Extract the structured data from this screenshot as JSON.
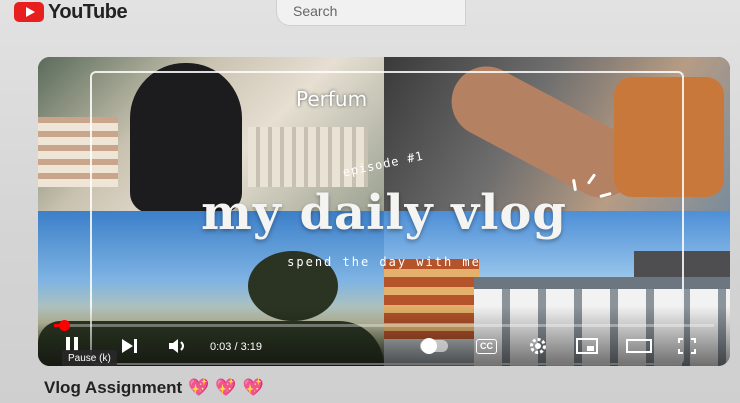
{
  "header": {
    "logo_text": "YouTube",
    "search_placeholder": "Search"
  },
  "player": {
    "overlay": {
      "label_top": "Perfum",
      "episode": "episode #1",
      "title": "my daily vlog",
      "subtitle": "spend the day with me"
    },
    "controls": {
      "current_time": "0:03",
      "separator": "/",
      "duration": "3:19",
      "progress_fraction": 0.015,
      "tooltip": "Pause (k)",
      "cc_label": "CC"
    },
    "accent_color": "#ff0000"
  },
  "video": {
    "title": "Vlog Assignment",
    "emoji": "💖",
    "emoji_count": 3
  },
  "icons": [
    "youtube-logo-icon",
    "pause-icon",
    "next-icon",
    "volume-icon",
    "autoplay-toggle",
    "cc-icon",
    "settings-gear-icon",
    "miniplayer-icon",
    "theater-icon",
    "fullscreen-icon",
    "heart-icon"
  ]
}
